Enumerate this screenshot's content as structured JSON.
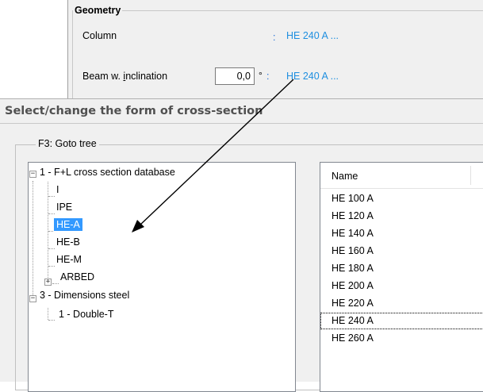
{
  "geometry": {
    "title": "Geometry",
    "column_label": "Column",
    "column_colon": ":",
    "column_value": "HE  240 A ...",
    "beam_label_pre": "Beam w. ",
    "beam_label_acc": "i",
    "beam_label_post": "nclination",
    "inclination_value": "0,0",
    "inclination_unit": "°",
    "beam_colon": ":",
    "beam_value": "HE  240 A ..."
  },
  "dialog": {
    "title": "Select/change the form of cross-section",
    "group_title": "F3: Goto tree",
    "tree": {
      "node_database": "1 - F+L cross section database",
      "node_i": "I",
      "node_ipe": "IPE",
      "node_hea": "HE-A",
      "node_heb": "HE-B",
      "node_hem": "HE-M",
      "node_arbed": "ARBED",
      "node_dimensions": "3 - Dimensions steel",
      "node_doublet": "1 - Double-T",
      "expander_expanded": "−",
      "expander_collapsed": "+"
    },
    "list": {
      "column_header": "Name",
      "rows": [
        "HE  100 A",
        "HE  120 A",
        "HE  140 A",
        "HE  160 A",
        "HE  180 A",
        "HE  200 A",
        "HE  220 A",
        "HE  240 A",
        "HE  260 A"
      ],
      "focused_index": 7
    }
  },
  "colors": {
    "link": "#1f8fe0",
    "selection": "#3399ff",
    "panel_bg": "#f0f0f0"
  }
}
